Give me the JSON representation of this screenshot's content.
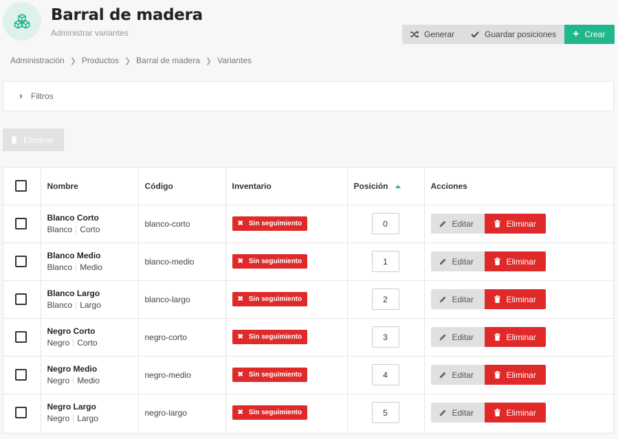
{
  "header": {
    "title": "Barral de madera",
    "subtitle": "Administrar variantes",
    "icon": "cubes-icon"
  },
  "toolbar": {
    "generate_label": "Generar",
    "save_positions_label": "Guardar posiciones",
    "create_label": "Crear"
  },
  "breadcrumb": [
    "Administración",
    "Productos",
    "Barral de madera",
    "Variantes"
  ],
  "filters": {
    "label": "Filtros"
  },
  "bulk": {
    "delete_label": "Eliminar"
  },
  "table": {
    "columns": [
      "Nombre",
      "Código",
      "Inventario",
      "Posición",
      "Acciones"
    ],
    "rows": [
      {
        "name": "Blanco Corto",
        "opt1": "Blanco",
        "opt2": "Corto",
        "code": "blanco-corto",
        "inventory": "Sin seguimiento",
        "position": "0",
        "edit": "Editar",
        "delete": "Eliminar"
      },
      {
        "name": "Blanco Medio",
        "opt1": "Blanco",
        "opt2": "Medio",
        "code": "blanco-medio",
        "inventory": "Sin seguimiento",
        "position": "1",
        "edit": "Editar",
        "delete": "Eliminar"
      },
      {
        "name": "Blanco Largo",
        "opt1": "Blanco",
        "opt2": "Largo",
        "code": "blanco-largo",
        "inventory": "Sin seguimiento",
        "position": "2",
        "edit": "Editar",
        "delete": "Eliminar"
      },
      {
        "name": "Negro Corto",
        "opt1": "Negro",
        "opt2": "Corto",
        "code": "negro-corto",
        "inventory": "Sin seguimiento",
        "position": "3",
        "edit": "Editar",
        "delete": "Eliminar"
      },
      {
        "name": "Negro Medio",
        "opt1": "Negro",
        "opt2": "Medio",
        "code": "negro-medio",
        "inventory": "Sin seguimiento",
        "position": "4",
        "edit": "Editar",
        "delete": "Eliminar"
      },
      {
        "name": "Negro Largo",
        "opt1": "Negro",
        "opt2": "Largo",
        "code": "negro-largo",
        "inventory": "Sin seguimiento",
        "position": "5",
        "edit": "Editar",
        "delete": "Eliminar"
      }
    ]
  },
  "colors": {
    "accent": "#21b68c",
    "danger": "#e02a2a",
    "neutral": "#dedede"
  }
}
